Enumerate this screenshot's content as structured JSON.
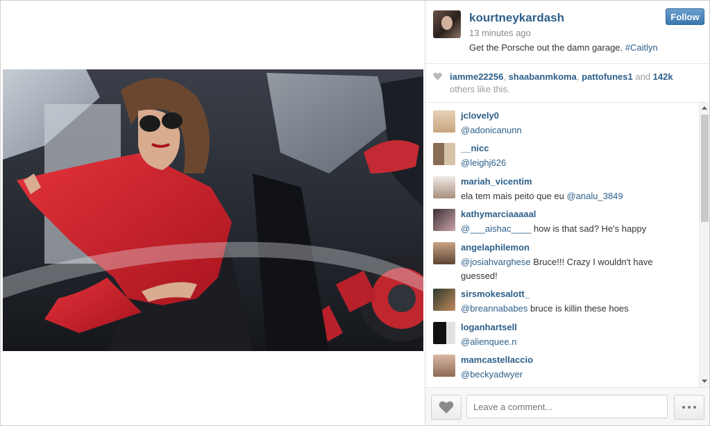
{
  "post": {
    "username": "kourtneykardash",
    "time": "13 minutes ago",
    "caption_text": "Get the Porsche out the damn garage. ",
    "caption_hashtag": "#Caitlyn",
    "follow_label": "Follow"
  },
  "likes": {
    "users": [
      "iamme22256",
      "shaabanmkoma",
      "pattofunes1"
    ],
    "sep1": ", ",
    "sep2": ", ",
    "and_text": " and ",
    "count": "142k",
    "suffix": "others like this."
  },
  "comments": [
    {
      "user": "jclovely0",
      "mention": "@adonicanunn",
      "text": ""
    },
    {
      "user": "__nicc",
      "mention": "@leighj626",
      "text": ""
    },
    {
      "user": "mariah_vicentim",
      "pre": "ela tem mais peito que eu ",
      "mention": "@analu_3849",
      "text": ""
    },
    {
      "user": "kathymarciaaaaal",
      "mention": "@___aishac____",
      "text": " how is that sad? He's happy"
    },
    {
      "user": "angelaphilemon",
      "mention": "@josiahvarghese",
      "text": " Bruce!!! Crazy I wouldn't have guessed!"
    },
    {
      "user": "sirsmokesalott_",
      "mention": "@breannababes",
      "text": " bruce is killin these hoes"
    },
    {
      "user": "loganhartsell",
      "mention": "@alienquee.n",
      "text": ""
    },
    {
      "user": "mamcastellaccio",
      "mention": "@beckyadwyer",
      "text": ""
    }
  ],
  "footer": {
    "comment_placeholder": "Leave a comment..."
  },
  "colors": {
    "link_blue": "#2d5f8a",
    "follow_button": "#3c77ad"
  },
  "icons": {
    "like": "heart-icon",
    "more": "ellipsis-icon"
  }
}
